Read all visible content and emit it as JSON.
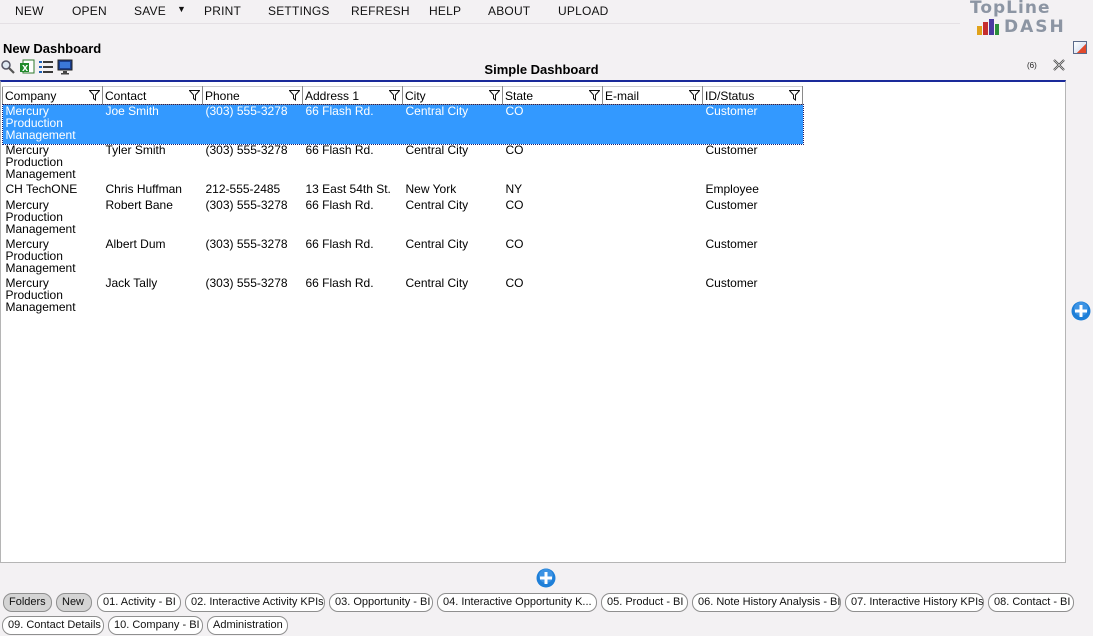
{
  "menu": {
    "new": "NEW",
    "open": "OPEN",
    "save": "SAVE",
    "print": "PRINT",
    "settings": "SETTINGS",
    "refresh": "REFRESH",
    "help": "HELP",
    "about": "ABOUT",
    "upload": "UPLOAD"
  },
  "logo": {
    "line1": "TopLine",
    "line2": "DASH"
  },
  "dashboard_title": "New Dashboard",
  "panel": {
    "title": "Simple Dashboard",
    "count": "(6)",
    "columns": [
      "Company",
      "Contact",
      "Phone",
      "Address 1",
      "City",
      "State",
      "E-mail",
      "ID/Status"
    ],
    "rows": [
      [
        "Mercury Production Management",
        "Joe Smith",
        "(303) 555-3278",
        "66 Flash Rd.",
        "Central City",
        "CO",
        "",
        "Customer"
      ],
      [
        "Mercury Production Management",
        "Tyler Smith",
        "(303) 555-3278",
        "66 Flash Rd.",
        "Central City",
        "CO",
        "",
        "Customer"
      ],
      [
        "CH TechONE",
        "Chris Huffman",
        "212-555-2485",
        "13 East 54th St.",
        "New York",
        "NY",
        "",
        "Employee"
      ],
      [
        "Mercury Production Management",
        "Robert Bane",
        "(303) 555-3278",
        "66 Flash Rd.",
        "Central City",
        "CO",
        "",
        "Customer"
      ],
      [
        "Mercury Production Management",
        "Albert Dum",
        "(303) 555-3278",
        "66 Flash Rd.",
        "Central City",
        "CO",
        "",
        "Customer"
      ],
      [
        "Mercury Production Management",
        "Jack Tally",
        "(303) 555-3278",
        "66 Flash Rd.",
        "Central City",
        "CO",
        "",
        "Customer"
      ]
    ],
    "selected_row": 0
  },
  "tabs": [
    "Folders",
    "New",
    "01. Activity - BI",
    "02. Interactive Activity KPIs",
    "03. Opportunity - BI",
    "04. Interactive Opportunity K...",
    "05. Product - BI",
    "06. Note History Analysis - BI",
    "07. Interactive History KPIs",
    "08. Contact - BI",
    "09. Contact Details",
    "10. Company - BI",
    "Administration"
  ],
  "icons": [
    "search-icon",
    "excel-export-icon",
    "list-icon",
    "monitor-icon",
    "close-icon",
    "add-icon",
    "filter-icon"
  ],
  "colors": {
    "selection": "#3399ff",
    "panel_border": "#1a2a9a",
    "add_button": "#1e7fd8"
  }
}
